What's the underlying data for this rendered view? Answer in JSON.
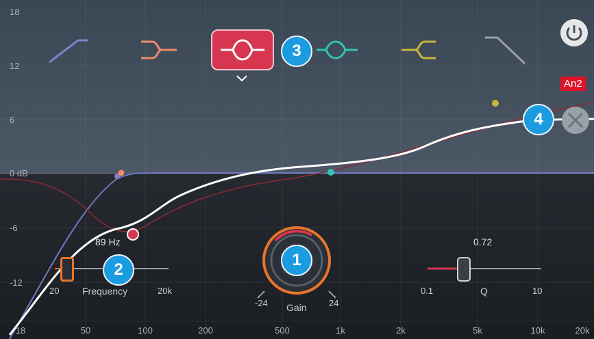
{
  "db_scale": [
    "18",
    "12",
    "6",
    "0 dB",
    "-6",
    "-12"
  ],
  "freq_scale": [
    "18",
    "50",
    "100",
    "200",
    "500",
    "1k",
    "2k",
    "5k",
    "10k",
    "20k"
  ],
  "filter_types": [
    {
      "icon": "high-pass-filter-icon",
      "color": "#7b84c9",
      "selected": false
    },
    {
      "icon": "low-shelf-filter-icon",
      "color": "#f08a6c",
      "selected": false
    },
    {
      "icon": "bell-filter-icon",
      "color": "#ffffff",
      "selected": true
    },
    {
      "icon": "notch-filter-icon",
      "color": "#2ec4b6",
      "selected": false
    },
    {
      "icon": "high-shelf-filter-icon",
      "color": "#c7b83a",
      "selected": false
    },
    {
      "icon": "low-pass-filter-icon",
      "color": "#9aa0a8",
      "selected": false
    }
  ],
  "badges": {
    "b1": "1",
    "b2": "2",
    "b3": "3",
    "b4": "4"
  },
  "frequency": {
    "value": "89 Hz",
    "label": "Frequency",
    "min": "20",
    "max": "20k",
    "slider_fraction": 0.12
  },
  "gain": {
    "label": "Gain",
    "min": "-24",
    "max": "24"
  },
  "q": {
    "value": "0.72",
    "label": "Q",
    "min": "0.1",
    "max": "10",
    "slider_fraction": 0.33
  },
  "tag": "An2",
  "colors": {
    "accent_red": "#d6364f",
    "badge_blue": "#1b9be0",
    "knob_orange": "#e8742c",
    "tag_red": "#e1132b"
  }
}
